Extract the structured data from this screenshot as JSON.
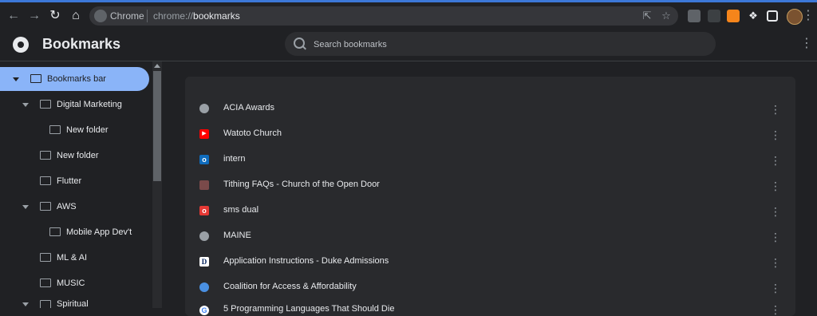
{
  "browser": {
    "omnibox_chip": "Chrome",
    "url_prefix": "chrome://",
    "url_host": "bookmarks"
  },
  "header": {
    "title": "Bookmarks",
    "search_placeholder": "Search bookmarks"
  },
  "sidebar": {
    "items": [
      {
        "label": "Bookmarks bar"
      },
      {
        "label": "Digital Marketing"
      },
      {
        "label": "New folder"
      },
      {
        "label": "New folder"
      },
      {
        "label": "Flutter"
      },
      {
        "label": "AWS"
      },
      {
        "label": "Mobile App Dev't"
      },
      {
        "label": "ML & AI"
      },
      {
        "label": "MUSIC"
      },
      {
        "label": "Spiritual"
      }
    ]
  },
  "bookmarks": {
    "items": [
      {
        "label": "ACIA Awards",
        "icon": "globe-icon",
        "color": "#9aa0a6"
      },
      {
        "label": "Watoto Church",
        "icon": "youtube-icon",
        "color": "#ff0000"
      },
      {
        "label": "intern",
        "icon": "outlook-icon",
        "color": "#0f6cbd"
      },
      {
        "label": "Tithing FAQs - Church of the Open Door",
        "icon": "church-icon",
        "color": "#7a4a4a"
      },
      {
        "label": "sms dual",
        "icon": "opera-icon",
        "color": "#e53935"
      },
      {
        "label": "MAINE",
        "icon": "globe-icon",
        "color": "#9aa0a6"
      },
      {
        "label": "Application Instructions - Duke Admissions",
        "icon": "duke-icon",
        "color": "#00205b"
      },
      {
        "label": "Coalition for Access & Affordability",
        "icon": "coalition-icon",
        "color": "#4a90e2"
      },
      {
        "label": "5 Programming Languages That Should Die",
        "icon": "google-icon",
        "color": "#ffffff"
      }
    ]
  },
  "colors": {
    "accent": "#8ab4f8",
    "background": "#202124",
    "card": "#292a2d"
  }
}
